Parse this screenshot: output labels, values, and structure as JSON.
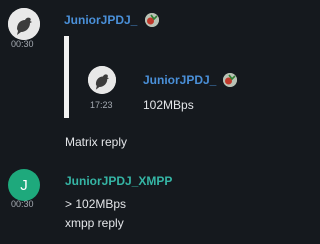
{
  "messages": [
    {
      "sender": "JuniorJPDJ_",
      "time": "00:30",
      "avatar_icon": "pigeon-avatar",
      "quote": {
        "sender": "JuniorJPDJ_",
        "time": "17:23",
        "text": "102MBps"
      },
      "text": "Matrix reply"
    },
    {
      "sender": "JuniorJPDJ_XMPP",
      "time": "00:30",
      "avatar_letter": "J",
      "avatar_color": "#1ea97c",
      "lines": [
        "> 102MBps",
        "xmpp reply"
      ]
    }
  ],
  "colors": {
    "background": "#15191e",
    "matrix_name": "#4a90d9",
    "xmpp_name": "#35b5a5",
    "quote_bar": "#f2f2f2"
  }
}
